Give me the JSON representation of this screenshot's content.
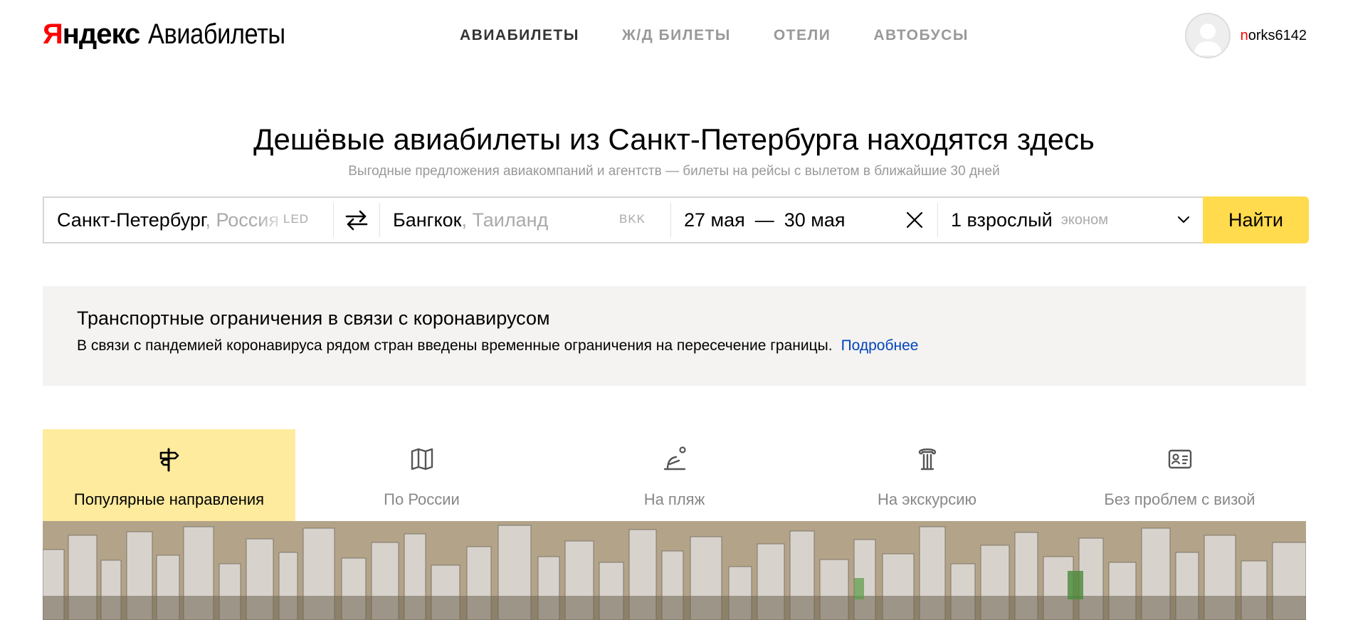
{
  "header": {
    "logo": {
      "brand_first": "Я",
      "brand_rest": "ндекс",
      "service": "Авиабилеты"
    },
    "nav": [
      {
        "label": "АВИАБИЛЕТЫ",
        "active": true
      },
      {
        "label": "Ж/Д БИЛЕТЫ",
        "active": false
      },
      {
        "label": "ОТЕЛИ",
        "active": false
      },
      {
        "label": "АВТОБУСЫ",
        "active": false
      }
    ],
    "user": {
      "name_first": "n",
      "name_rest": "orks6142"
    }
  },
  "hero": {
    "title": "Дешёвые авиабилеты из Санкт-Петербурга находятся здесь",
    "subtitle": "Выгодные предложения авиакомпаний и агентств — билеты на рейсы с вылетом в ближайшие 30 дней"
  },
  "search": {
    "from": {
      "city": "Санкт-Петербург",
      "country": ", Россия",
      "code": "LED"
    },
    "to": {
      "city": "Бангкок",
      "country": ", Таиланд",
      "code": "BKK"
    },
    "dates": {
      "start": "27 мая",
      "separator": "—",
      "end": "30 мая"
    },
    "passengers": {
      "count": "1 взрослый",
      "class": "эконом"
    },
    "button": "Найти",
    "accent_color": "#ffdb4d"
  },
  "notice": {
    "title": "Транспортные ограничения в связи с коронавирусом",
    "text": "В связи с пандемией коронавируса рядом стран введены временные ограничения на пересечение границы.",
    "link": "Подробнее"
  },
  "tabs": [
    {
      "label": "Популярные направления",
      "icon": "signpost-icon",
      "active": true
    },
    {
      "label": "По России",
      "icon": "map-icon",
      "active": false
    },
    {
      "label": "На пляж",
      "icon": "beach-icon",
      "active": false
    },
    {
      "label": "На экскурсию",
      "icon": "column-icon",
      "active": false
    },
    {
      "label": "Без проблем с визой",
      "icon": "passport-icon",
      "active": false
    }
  ]
}
